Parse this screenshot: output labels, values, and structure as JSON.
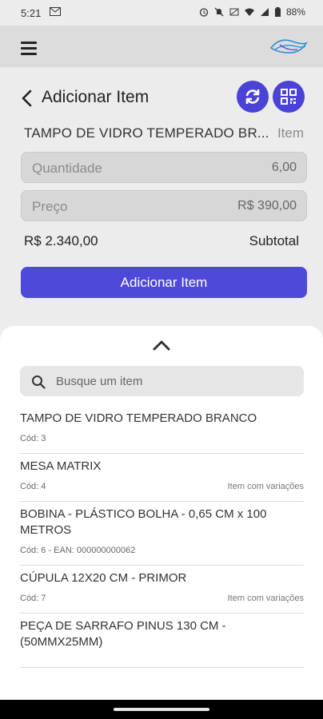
{
  "status": {
    "time": "5:21",
    "battery": "88%"
  },
  "header": {
    "title": "Adicionar Item"
  },
  "item": {
    "name": "TAMPO DE VIDRO TEMPERADO BR...",
    "type": "Item"
  },
  "fields": {
    "quantity": {
      "label": "Quantidade",
      "value": "6,00"
    },
    "price": {
      "label": "Preço",
      "value": "R$ 390,00"
    }
  },
  "subtotal": {
    "value": "R$ 2.340,00",
    "label": "Subtotal"
  },
  "add_button": "Adicionar Item",
  "colors": {
    "accent": "#4e49d9",
    "background": "#ececec",
    "app_bar": "#dcdcdc"
  },
  "search": {
    "placeholder": "Busque um item"
  },
  "items": [
    {
      "name": "TAMPO DE VIDRO TEMPERADO BRANCO",
      "code": "Cód: 3",
      "variant": ""
    },
    {
      "name": "MESA MATRIX",
      "code": "Cód: 4",
      "variant": "Item com variações"
    },
    {
      "name": "BOBINA - PLÁSTICO BOLHA - 0,65 CM x 100 METROS",
      "code": "Cód: 6 - EAN: 000000000062",
      "variant": ""
    },
    {
      "name": "CÚPULA 12X20 CM - PRIMOR",
      "code": "Cód: 7",
      "variant": "Item com variações"
    },
    {
      "name": "PEÇA DE SARRAFO PINUS 130 CM - (50MMX25MM)",
      "code": "",
      "variant": ""
    }
  ],
  "icons": {
    "menu": "hamburger-menu-icon",
    "back": "chevron-left-icon",
    "refresh": "sync-icon",
    "qr": "qr-code-icon",
    "collapse": "chevron-up-icon",
    "search": "search-icon"
  }
}
